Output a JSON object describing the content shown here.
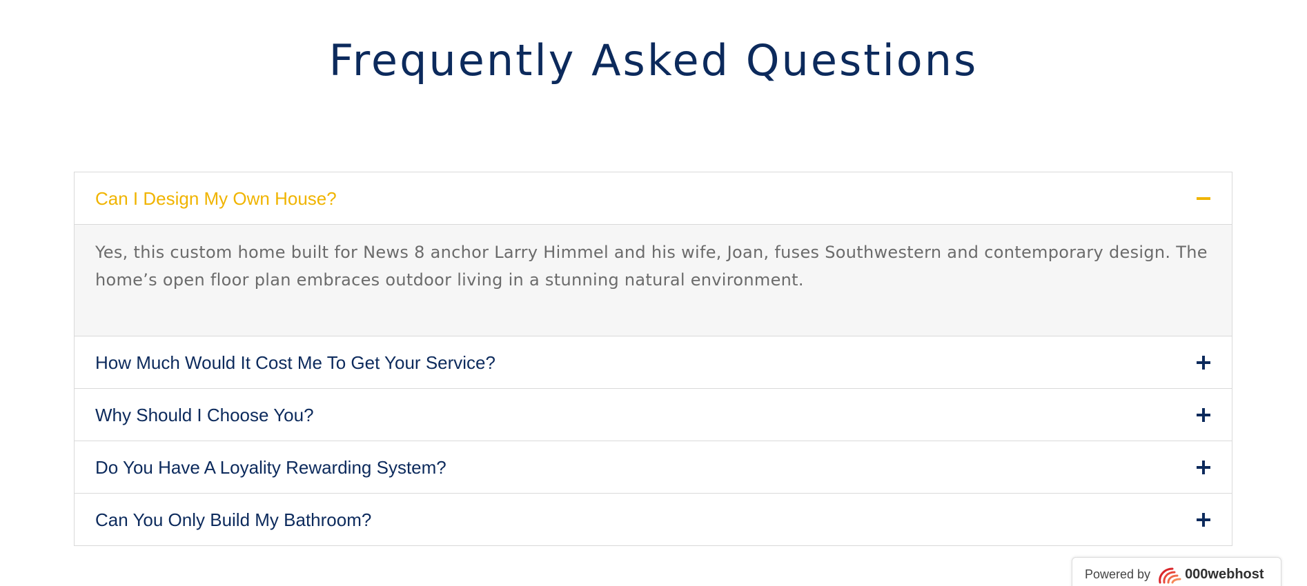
{
  "colors": {
    "title": "#0c2a5c",
    "question_active": "#f0b400",
    "question": "#0c2a5c",
    "answer": "#6b6b6b",
    "toggle_active": "#f0b400",
    "toggle": "#0c2a5c"
  },
  "page": {
    "title": "Frequently Asked Questions"
  },
  "faq": {
    "items": [
      {
        "question": "Can I Design My Own House?",
        "expanded": true,
        "toggle_icon": "minus-icon",
        "answer": "Yes, this custom home built for News 8 anchor Larry Himmel and his wife, Joan, fuses Southwestern and contemporary design. The home’s open floor plan embraces outdoor living in a stunning natural environment."
      },
      {
        "question": "How Much Would It Cost Me To Get Your Service?",
        "expanded": false,
        "toggle_icon": "plus-icon"
      },
      {
        "question": "Why Should I Choose You?",
        "expanded": false,
        "toggle_icon": "plus-icon"
      },
      {
        "question": "Do You Have A Loyality Rewarding System?",
        "expanded": false,
        "toggle_icon": "plus-icon"
      },
      {
        "question": "Can You Only Build My Bathroom?",
        "expanded": false,
        "toggle_icon": "plus-icon"
      }
    ]
  },
  "badge": {
    "powered_label": "Powered by",
    "host_name": "000webhost",
    "logo_icon": "000webhost-logo-icon"
  }
}
